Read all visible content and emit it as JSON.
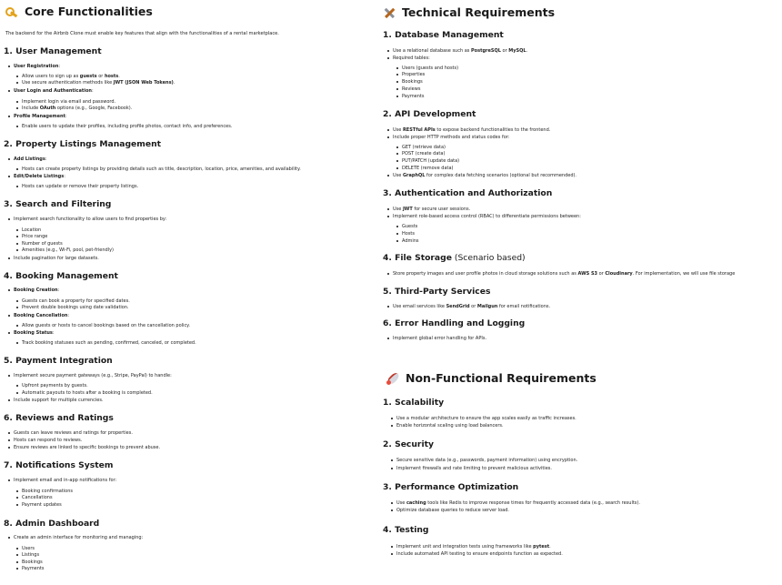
{
  "left": {
    "title": "Core Functionalities",
    "intro": "The backend for the Airbnb Clone must enable key features that align with the functionalities of a rental marketplace.",
    "s1": {
      "heading": "1. User Management",
      "reg_label": "User Registration",
      "reg_1_a": "Allow users to sign up as ",
      "reg_1_b": "guests",
      "reg_1_c": " or ",
      "reg_1_d": "hosts",
      "reg_1_e": ".",
      "reg_2_a": "Use secure authentication methods like ",
      "reg_2_b": "JWT (JSON Web Tokens)",
      "reg_2_c": ".",
      "login_label": "User Login and Authentication",
      "login_1": "Implement login via email and password.",
      "login_2_a": "Include ",
      "login_2_b": "OAuth",
      "login_2_c": " options (e.g., Google, Facebook).",
      "profile_label": "Profile Management",
      "profile_1": "Enable users to update their profiles, including profile photos, contact info, and preferences."
    },
    "s2": {
      "heading": "2. Property Listings Management",
      "add_label": "Add Listings",
      "add_1": "Hosts can create property listings by providing details such as title, description, location, price, amenities, and availability.",
      "edit_label": "Edit/Delete Listings",
      "edit_1": "Hosts can update or remove their property listings."
    },
    "s3": {
      "heading": "3. Search and Filtering",
      "item_1": "Implement search functionality to allow users to find properties by:",
      "sub": [
        "Location",
        "Price range",
        "Number of guests",
        "Amenities (e.g., Wi-Fi, pool, pet-friendly)"
      ],
      "item_2": "Include pagination for large datasets."
    },
    "s4": {
      "heading": "4. Booking Management",
      "create_label": "Booking Creation",
      "create_1": "Guests can book a property for specified dates.",
      "create_2": "Prevent double bookings using date validation.",
      "cancel_label": "Booking Cancellation",
      "cancel_1": "Allow guests or hosts to cancel bookings based on the cancellation policy.",
      "status_label": "Booking Status",
      "status_1": "Track booking statuses such as pending, confirmed, canceled, or completed."
    },
    "s5": {
      "heading": "5. Payment Integration",
      "item_1": "Implement secure payment gateways (e.g., Stripe, PayPal) to handle:",
      "sub": [
        "Upfront payments by guests.",
        "Automatic payouts to hosts after a booking is completed."
      ],
      "item_2": "Include support for multiple currencies."
    },
    "s6": {
      "heading": "6. Reviews and Ratings",
      "items": [
        "Guests can leave reviews and ratings for properties.",
        "Hosts can respond to reviews.",
        "Ensure reviews are linked to specific bookings to prevent abuse."
      ]
    },
    "s7": {
      "heading": "7. Notifications System",
      "item_1": "Implement email and in-app notifications for:",
      "sub": [
        "Booking confirmations",
        "Cancellations",
        "Payment updates"
      ]
    },
    "s8": {
      "heading": "8. Admin Dashboard",
      "item_1": "Create an admin interface for monitoring and managing:",
      "sub": [
        "Users",
        "Listings",
        "Bookings",
        "Payments"
      ]
    }
  },
  "right": {
    "title": "Technical Requirements",
    "t1": {
      "heading": "1. Database Management",
      "item_1_a": "Use a relational database such as ",
      "item_1_b": "PostgreSQL",
      "item_1_c": " or ",
      "item_1_d": "MySQL",
      "item_1_e": ".",
      "item_2": "Required tables:",
      "sub": [
        "Users (guests and hosts)",
        "Properties",
        "Bookings",
        "Reviews",
        "Payments"
      ]
    },
    "t2": {
      "heading": "2. API Development",
      "item_1_a": "Use ",
      "item_1_b": "RESTful APIs",
      "item_1_c": " to expose backend functionalities to the frontend.",
      "item_2": "Include proper HTTP methods and status codes for:",
      "sub": [
        "GET (retrieve data)",
        "POST (create data)",
        "PUT/PATCH (update data)",
        "DELETE (remove data)"
      ],
      "item_3_a": "Use ",
      "item_3_b": "GraphQL",
      "item_3_c": " for complex data fetching scenarios (optional but recommended)."
    },
    "t3": {
      "heading": "3. Authentication and Authorization",
      "item_1_a": "Use ",
      "item_1_b": "JWT",
      "item_1_c": " for secure user sessions.",
      "item_2": "Implement role-based access control (RBAC) to differentiate permissions between:",
      "sub": [
        "Guests",
        "Hosts",
        "Admins"
      ]
    },
    "t4": {
      "heading_a": "4. File Storage",
      "heading_b": " (Scenario based)",
      "item_1_a": "Store property images and user profile photos in cloud storage solutions such as ",
      "item_1_b": "AWS S3",
      "item_1_c": " or ",
      "item_1_d": "Cloudinary",
      "item_1_e": ". For implementation, we will use file storage"
    },
    "t5": {
      "heading": "5. Third-Party Services",
      "item_1_a": "Use email services like ",
      "item_1_b": "SendGrid",
      "item_1_c": " or ",
      "item_1_d": "Mailgun",
      "item_1_e": " for email notifications."
    },
    "t6": {
      "heading": "6. Error Handling and Logging",
      "item_1": "Implement global error handling for APIs."
    },
    "nf_title": "Non-Functional Requirements",
    "n1": {
      "heading": "1. Scalability",
      "items": [
        "Use a modular architecture to ensure the app scales easily as traffic increases.",
        "Enable horizontal scaling using load balancers."
      ]
    },
    "n2": {
      "heading": "2. Security",
      "items": [
        "Secure sensitive data (e.g., passwords, payment information) using encryption.",
        "Implement firewalls and rate limiting to prevent malicious activities."
      ]
    },
    "n3": {
      "heading": "3. Performance Optimization",
      "item_1_a": "Use ",
      "item_1_b": "caching",
      "item_1_c": " tools like Redis to improve response times for frequently accessed data (e.g., search results).",
      "item_2": "Optimize database queries to reduce server load."
    },
    "n4": {
      "heading": "4. Testing",
      "item_1_a": "Implement unit and integration tests using frameworks like ",
      "item_1_b": "pytest",
      "item_1_c": ".",
      "item_2": "Include automated API testing to ensure endpoints function as expected."
    }
  }
}
